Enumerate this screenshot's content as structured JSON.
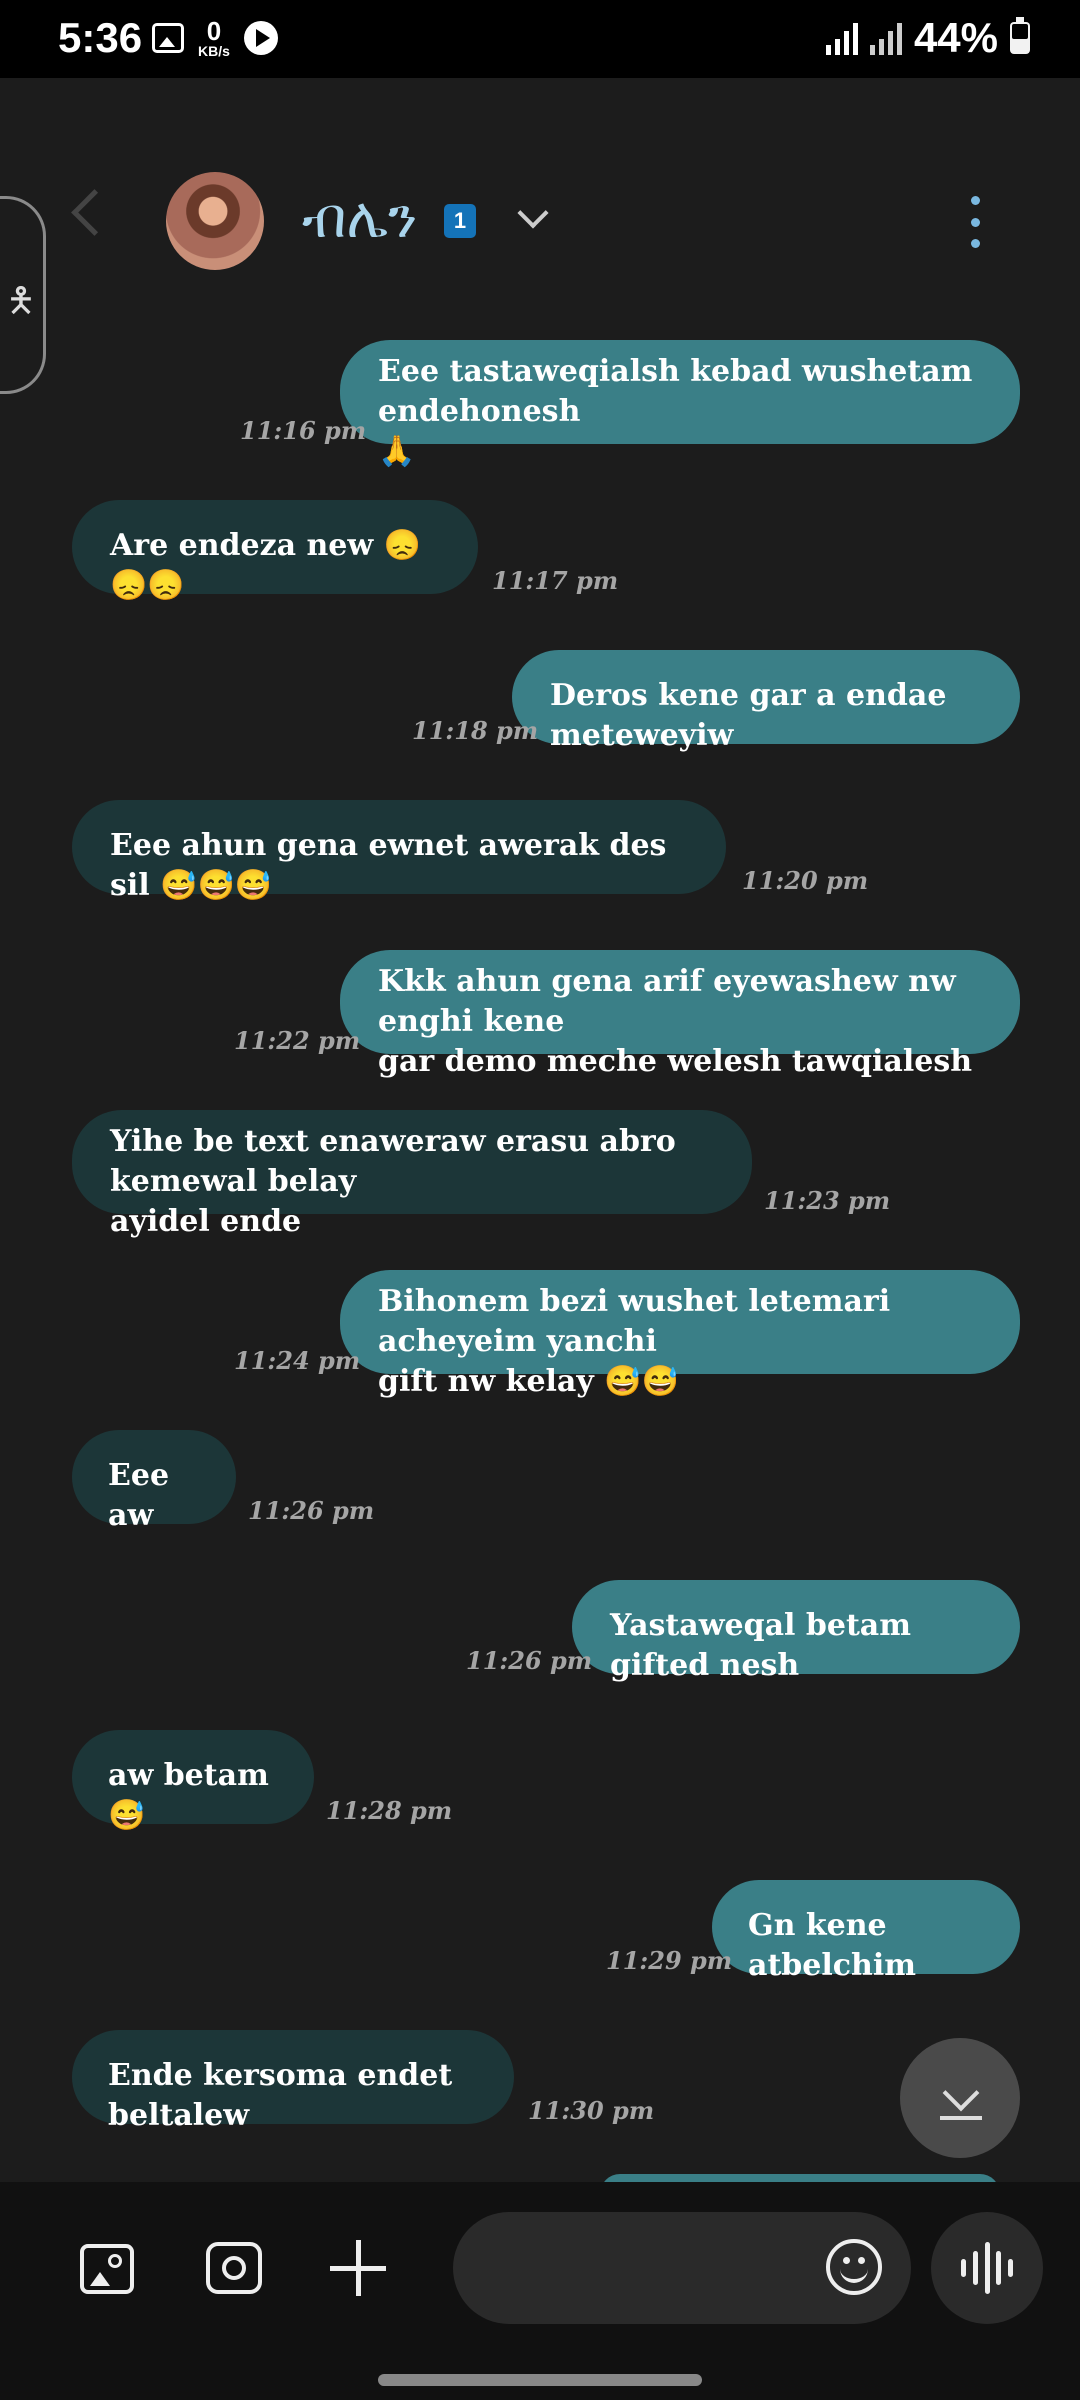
{
  "status_bar": {
    "time": "5:36",
    "net_speed_value": "0",
    "net_speed_unit": "KB/s",
    "battery": "44%"
  },
  "header": {
    "contact_name": "ብሌን",
    "badge": "1",
    "accent": "#a9d4ec"
  },
  "colors": {
    "outgoing_bubble": "#3a7f87",
    "incoming_bubble": "#1c3638",
    "background": "#1c1c1c"
  },
  "messages": [
    {
      "dir": "out",
      "text": "Eee tastaweqialsh kebad wushetam endehonesh\n🙏",
      "time": "11:16 pm"
    },
    {
      "dir": "in",
      "text": "Are endeza new 😞😞😞",
      "time": "11:17 pm"
    },
    {
      "dir": "out",
      "text": "Deros kene gar a endae meteweyiw",
      "time": "11:18 pm"
    },
    {
      "dir": "in",
      "text": "Eee ahun gena ewnet awerak des sil 😅😅😅",
      "time": "11:20 pm"
    },
    {
      "dir": "out",
      "text": "Kkk ahun gena arif eyewashew nw enghi kene\ngar demo meche welesh tawqialesh",
      "time": "11:22 pm"
    },
    {
      "dir": "in",
      "text": "Yihe be text enaweraw erasu abro kemewal belay\nayidel ende",
      "time": "11:23 pm"
    },
    {
      "dir": "out",
      "text": "Bihonem bezi wushet letemari acheyeim yanchi\ngift nw kelay 😅😅",
      "time": "11:24 pm"
    },
    {
      "dir": "in",
      "text": "Eee aw",
      "time": "11:26 pm"
    },
    {
      "dir": "out",
      "text": "Yastaweqal betam gifted nesh",
      "time": "11:26 pm"
    },
    {
      "dir": "in",
      "text": "aw betam 😅",
      "time": "11:28 pm"
    },
    {
      "dir": "out",
      "text": "Gn kene atbelchim",
      "time": "11:29 pm"
    },
    {
      "dir": "in",
      "text": "Ende kersoma endet beltalew",
      "time": "11:30 pm"
    }
  ],
  "composer": {
    "placeholder": "",
    "icons": [
      "gallery-icon",
      "camera-icon",
      "plus-icon",
      "emoji-icon",
      "voice-wave-icon"
    ]
  }
}
